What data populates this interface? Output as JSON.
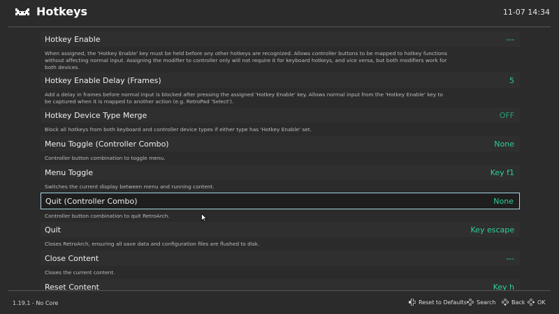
{
  "header": {
    "title": "Hotkeys",
    "clock": "11-07 14:34"
  },
  "entries": [
    {
      "label": "Hotkey Enable",
      "value": "---",
      "description": "When assigned, the 'Hotkey Enable' key must be held before any other hotkeys are recognized. Allows controller buttons to be mapped to hotkey functions without affecting normal input. Assigning the modifier to controller only will not require it for keyboard hotkeys, and vice versa, but both modifiers work for both devices."
    },
    {
      "label": "Hotkey Enable Delay (Frames)",
      "value": "5",
      "description": "Add a delay in frames before normal input is blocked after pressing the assigned 'Hotkey Enable' key. Allows normal input from the 'Hotkey Enable' key to be captured when it is mapped to another action (e.g. RetroPad 'Select')."
    },
    {
      "label": "Hotkey Device Type Merge",
      "value": "OFF",
      "description": "Block all hotkeys from both keyboard and controller device types if either type has 'Hotkey Enable' set."
    },
    {
      "label": "Menu Toggle (Controller Combo)",
      "value": "None",
      "description": "Controller button combination to toggle menu."
    },
    {
      "label": "Menu Toggle",
      "value": "Key f1",
      "description": "Switches the current display between menu and running content."
    },
    {
      "label": "Quit (Controller Combo)",
      "value": "None",
      "description": "Controller button combination to quit RetroArch."
    },
    {
      "label": "Quit",
      "value": "Key escape",
      "description": "Closes RetroArch, ensuring all save data and configuration files are flushed to disk."
    },
    {
      "label": "Close Content",
      "value": "---",
      "description": "Closes the current content."
    },
    {
      "label": "Reset Content",
      "value": "Key h",
      "description": ""
    }
  ],
  "footer": {
    "version": "1.19.1 - No Core",
    "reset_label": "Reset to Defaults",
    "search_label": "Search",
    "back_label": "Back",
    "ok_label": "OK"
  },
  "colors": {
    "accent": "#2fcf9a",
    "selection_border": "#a7d7e2",
    "background": "#2b2b2b"
  }
}
